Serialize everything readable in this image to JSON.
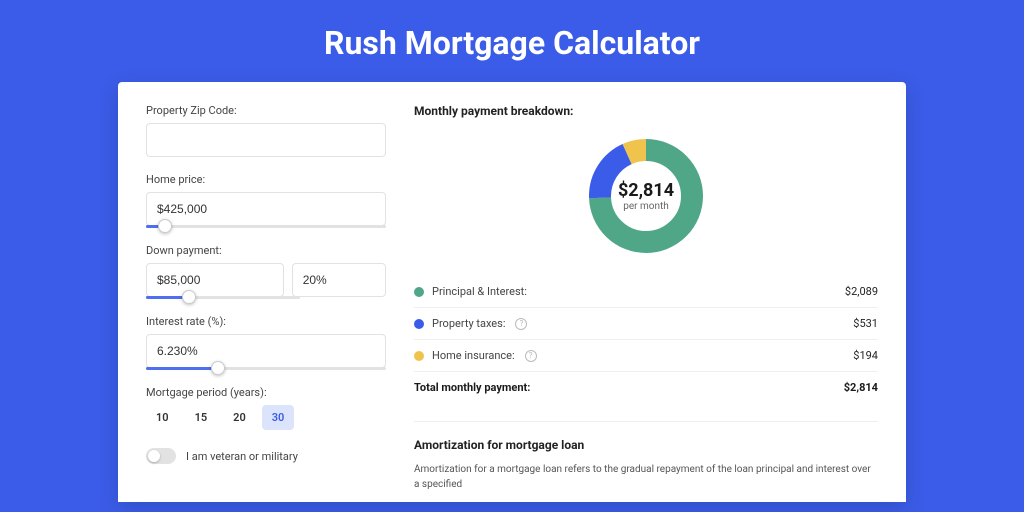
{
  "title": "Rush Mortgage Calculator",
  "left": {
    "zip": {
      "label": "Property Zip Code:",
      "value": ""
    },
    "homePrice": {
      "label": "Home price:",
      "value": "$425,000"
    },
    "downPayment": {
      "label": "Down payment:",
      "amount": "$85,000",
      "percent": "20%"
    },
    "interest": {
      "label": "Interest rate (%):",
      "value": "6.230%"
    },
    "period": {
      "label": "Mortgage period (years):",
      "options": [
        "10",
        "15",
        "20",
        "30"
      ],
      "selected": "30"
    },
    "veteran": {
      "label": "I am veteran or military"
    }
  },
  "right": {
    "heading": "Monthly payment breakdown:",
    "centerValue": "$2,814",
    "centerSub": "per month",
    "items": [
      {
        "label": "Principal & Interest:",
        "value": "$2,089",
        "color": "#4fa788",
        "hasInfo": false
      },
      {
        "label": "Property taxes:",
        "value": "$531",
        "color": "#3b5ce8",
        "hasInfo": true
      },
      {
        "label": "Home insurance:",
        "value": "$194",
        "color": "#f0c44c",
        "hasInfo": true
      }
    ],
    "totalLabel": "Total monthly payment:",
    "totalValue": "$2,814",
    "amortHeading": "Amortization for mortgage loan",
    "amortText": "Amortization for a mortgage loan refers to the gradual repayment of the loan principal and interest over a specified"
  },
  "chart_data": {
    "type": "pie",
    "title": "Monthly payment breakdown",
    "series": [
      {
        "name": "Principal & Interest",
        "value": 2089
      },
      {
        "name": "Property taxes",
        "value": 531
      },
      {
        "name": "Home insurance",
        "value": 194
      }
    ],
    "total": 2814,
    "unit": "USD/month"
  }
}
